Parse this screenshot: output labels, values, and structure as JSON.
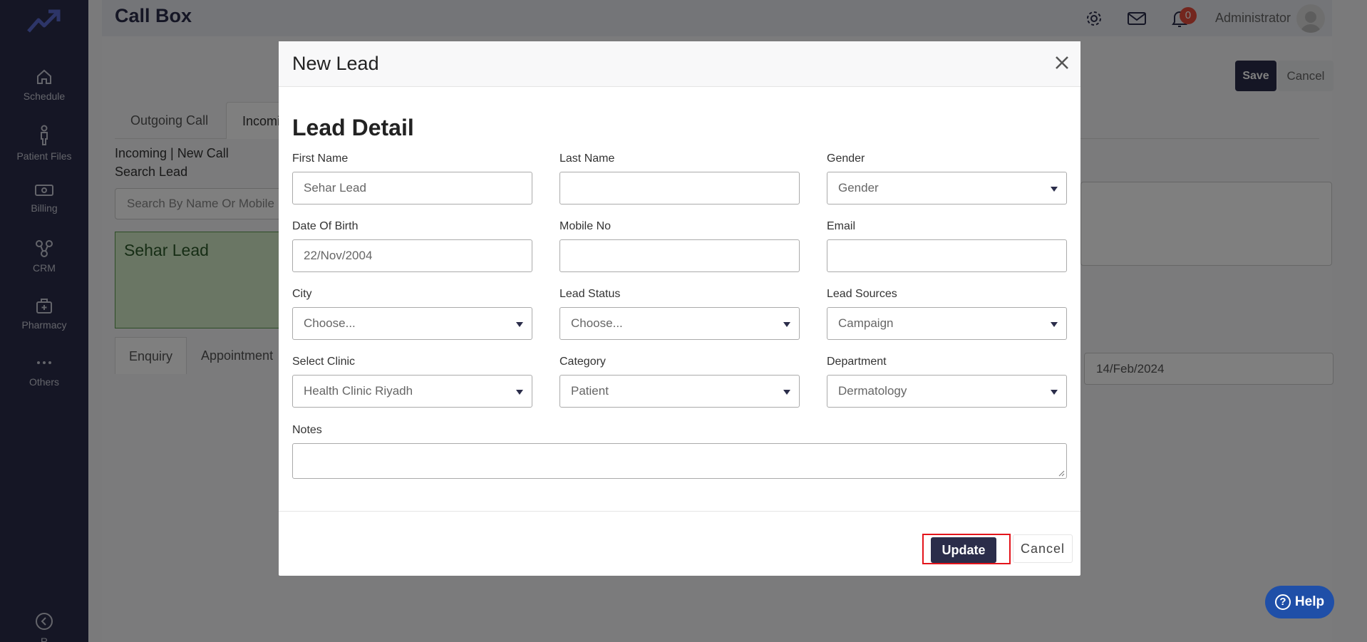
{
  "sidebar": {
    "items": [
      {
        "label": "Schedule",
        "icon": "home-icon"
      },
      {
        "label": "Patient Files",
        "icon": "person-icon"
      },
      {
        "label": "Billing",
        "icon": "money-icon"
      },
      {
        "label": "CRM",
        "icon": "network-icon"
      },
      {
        "label": "Pharmacy",
        "icon": "medical-bag-icon"
      },
      {
        "label": "Others",
        "icon": "more-dots-icon"
      }
    ],
    "bottom_label": "R"
  },
  "topbar": {
    "title": "Call Box",
    "notification_count": "0",
    "user": "Administrator"
  },
  "page": {
    "save_label": "Save",
    "cancel_label": "Cancel",
    "tabs": [
      "Outgoing Call",
      "Incomin"
    ],
    "incoming_line": "Incoming | New Call",
    "search_lead_label": "Search Lead",
    "search_lead_placeholder": "Search By Name Or Mobile",
    "lead_card_name": "Sehar Lead",
    "subtabs": [
      "Enquiry",
      "Appointment"
    ],
    "right_date": "14/Feb/2024",
    "help_label": "Help"
  },
  "modal": {
    "title": "New Lead",
    "section_title": "Lead Detail",
    "fields": {
      "first_name": {
        "label": "First Name",
        "value": "Sehar Lead"
      },
      "last_name": {
        "label": "Last Name",
        "value": ""
      },
      "gender": {
        "label": "Gender",
        "value": "Gender"
      },
      "dob": {
        "label": "Date Of Birth",
        "value": "22/Nov/2004"
      },
      "mobile": {
        "label": "Mobile No",
        "value": ""
      },
      "email": {
        "label": "Email",
        "value": ""
      },
      "city": {
        "label": "City",
        "value": "Choose..."
      },
      "lead_status": {
        "label": "Lead Status",
        "value": "Choose..."
      },
      "lead_sources": {
        "label": "Lead Sources",
        "value": "Campaign"
      },
      "clinic": {
        "label": "Select Clinic",
        "value": "Health Clinic Riyadh"
      },
      "category": {
        "label": "Category",
        "value": "Patient"
      },
      "department": {
        "label": "Department",
        "value": "Dermatology"
      },
      "notes": {
        "label": "Notes",
        "value": ""
      }
    },
    "update_label": "Update",
    "cancel_label": "Cancel"
  },
  "colors": {
    "sidebar": "#2b2d4a",
    "primary_button": "#2b2d4a",
    "highlight_border": "#e3141b",
    "help_button": "#1f4fa8",
    "badge": "#e74c3c"
  }
}
